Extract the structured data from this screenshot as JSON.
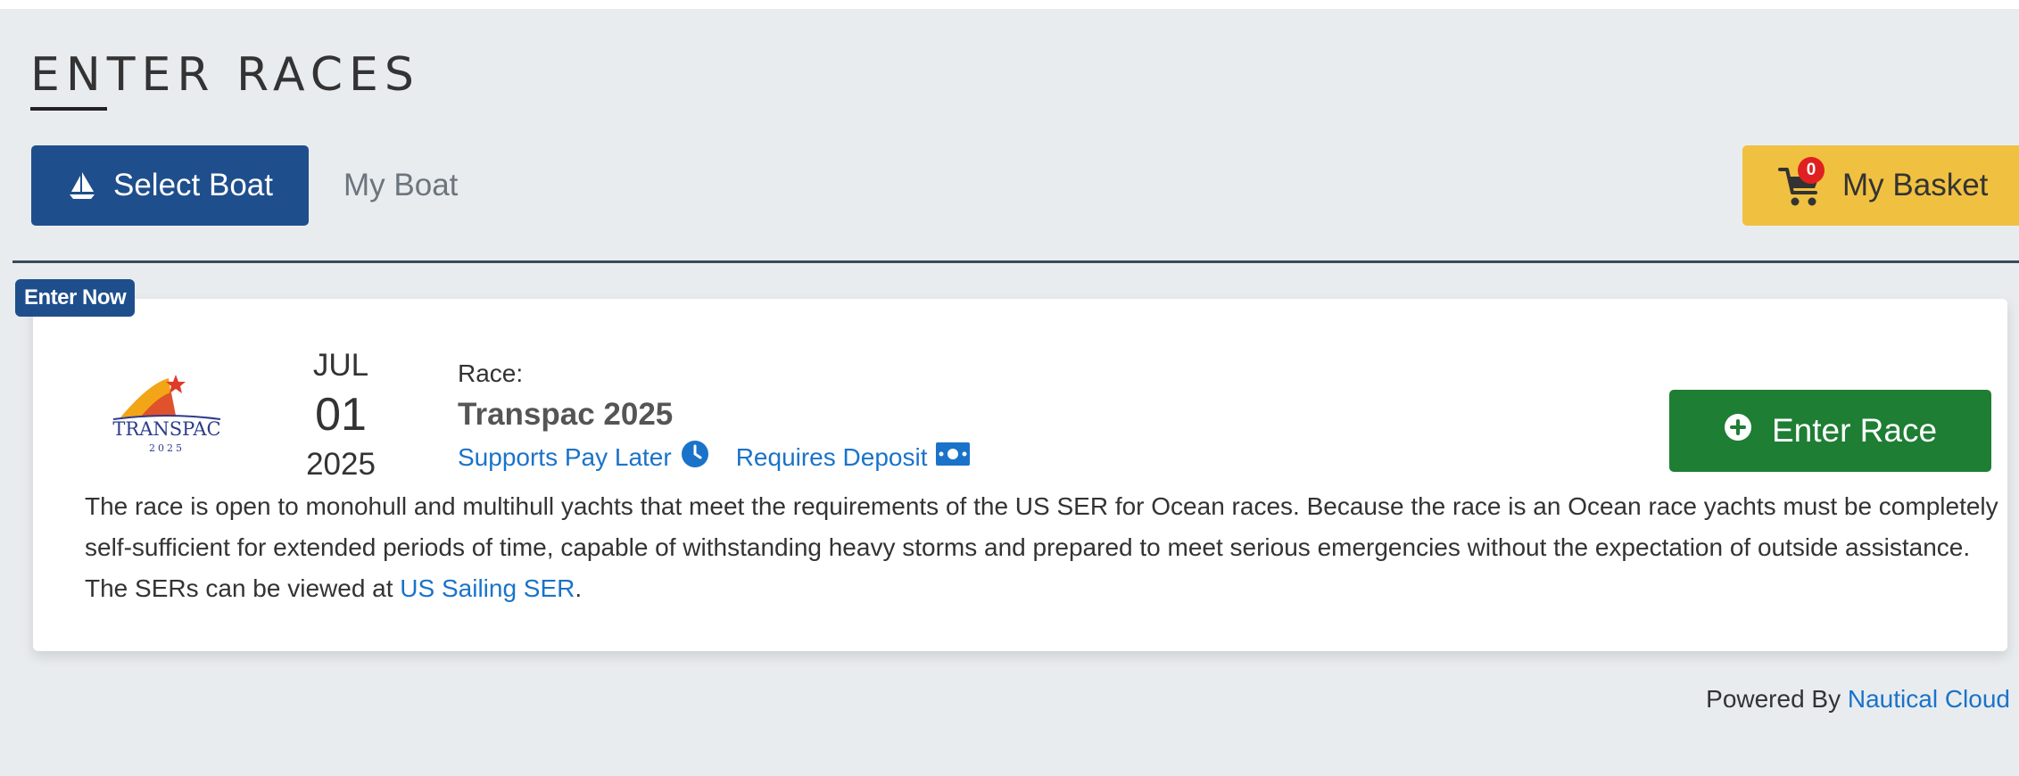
{
  "header": {
    "title": "ENTER RACES"
  },
  "toolbar": {
    "select_boat_label": "Select Boat",
    "select_boat_icon": "sailboat-icon",
    "my_boat_label": "My Boat",
    "basket_label": "My Basket",
    "basket_icon": "cart-icon",
    "basket_count": "0"
  },
  "race": {
    "status_badge": "Enter Now",
    "logo_text": "TRANSPAC",
    "logo_year": "2025",
    "date_month": "JUL",
    "date_day": "01",
    "date_year": "2025",
    "race_label": "Race:",
    "name": "Transpac 2025",
    "pay_later_label": "Supports Pay Later",
    "pay_later_icon": "clock-icon",
    "deposit_label": "Requires Deposit",
    "deposit_icon": "money-icon",
    "enter_button_label": "Enter Race",
    "enter_button_icon": "plus-circle-icon",
    "description": "The race is open to monohull and multihull yachts that meet the requirements of the US SER for Ocean races. Because the race is an Ocean race yachts must be completely self-sufficient for extended periods of time, capable of withstanding heavy storms and prepared to meet serious emergencies without the expectation of outside assistance. The SERs can be viewed at",
    "description_link": "US Sailing SER",
    "description_end": "."
  },
  "footer": {
    "powered_by": "Powered By",
    "brand_link": "Nautical Cloud"
  },
  "colors": {
    "primary": "#1f4e8c",
    "success": "#1e7e34",
    "warning": "#f0c040",
    "link": "#1a73c9",
    "background": "#e9ecef"
  }
}
